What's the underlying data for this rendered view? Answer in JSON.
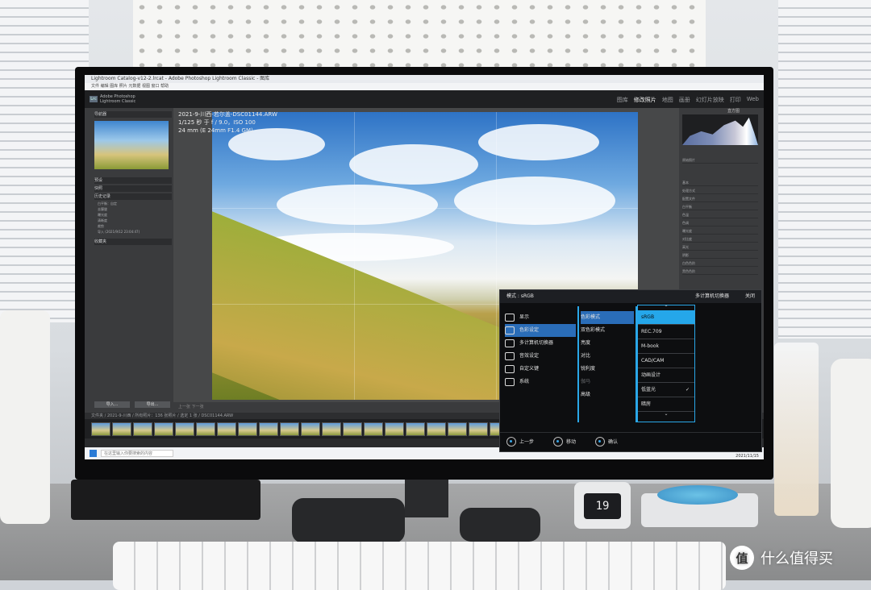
{
  "watermark": {
    "logo": "值",
    "text": "什么值得买"
  },
  "clock": {
    "display": "19"
  },
  "window": {
    "title": "Lightroom Catalog-v12-2.lrcat - Adobe Photoshop Lightroom Classic - 图库",
    "menu": "文件  编辑  图库  照片  元数据  视图  窗口  帮助"
  },
  "lightroom": {
    "brand_top": "Adobe Photoshop",
    "brand_bottom": "Lightroom Classic",
    "modules": [
      "图库",
      "修改照片",
      "地图",
      "画册",
      "幻灯片放映",
      "打印",
      "Web"
    ],
    "active_module": "修改照片",
    "left_panel": {
      "navigator": "导航器",
      "presets": "预设",
      "snapshots": "快照",
      "history": "历史记录",
      "history_items": [
        "白平衡：自定",
        "去朦胧",
        "曝光度",
        "清晰度",
        "裁剪",
        "导入 (2021/9/12 23:04:47)"
      ],
      "collections": "收藏夹",
      "import": "导入...",
      "export": "导出..."
    },
    "photo_info": {
      "filename": "2021-9-川西-若尔盖-DSC01144.ARW",
      "exposure": "1/125 秒 于 f / 9.0，ISO 100",
      "lens": "24 mm (E 24mm F1.4 GM)"
    },
    "bottom_toolbar": "上一张  下一张",
    "right_panel": {
      "histogram_label": "直方图",
      "rows": [
        "原始照片",
        "基本",
        "处理方式",
        "配置文件",
        "白平衡",
        "色温",
        "色调",
        "曝光度",
        "对比度",
        "高光",
        "阴影",
        "白色色阶",
        "黑色色阶"
      ]
    },
    "filmstrip_path": "文件夹 / 2021-9-川西 / 所有照片：136 张照片 / 选定 1 张 / DSC01144.ARW"
  },
  "taskbar": {
    "search": "在这里输入你要搜索的内容",
    "time": "23:04",
    "date": "2021/11/15"
  },
  "osd": {
    "mode_label": "模式",
    "mode_value": "sRGB",
    "selector": "多计算机切换器",
    "close": "关闭",
    "menu": [
      {
        "label": "显示",
        "icon": "display-icon",
        "selected": false
      },
      {
        "label": "色彩设定",
        "icon": "color-palette-icon",
        "selected": true
      },
      {
        "label": "多计算机切换器",
        "icon": "kvm-switch-icon",
        "selected": false
      },
      {
        "label": "音效设定",
        "icon": "speaker-icon",
        "selected": false
      },
      {
        "label": "自定义键",
        "icon": "user-icon",
        "selected": false
      },
      {
        "label": "系统",
        "icon": "wrench-icon",
        "selected": false
      }
    ],
    "submenu": [
      {
        "label": "色彩模式",
        "selected": true,
        "dim": false
      },
      {
        "label": "双色彩模式",
        "selected": false,
        "dim": false
      },
      {
        "label": "亮度",
        "selected": false,
        "dim": false
      },
      {
        "label": "对比",
        "selected": false,
        "dim": false
      },
      {
        "label": "锐利度",
        "selected": false,
        "dim": false
      },
      {
        "label": "伽马",
        "selected": false,
        "dim": true
      },
      {
        "label": "高级",
        "selected": false,
        "dim": false
      }
    ],
    "options": [
      {
        "label": "sRGB",
        "selected": true,
        "checked": false
      },
      {
        "label": "REC.709",
        "selected": false,
        "checked": false
      },
      {
        "label": "M-book",
        "selected": false,
        "checked": false
      },
      {
        "label": "CAD/CAM",
        "selected": false,
        "checked": false
      },
      {
        "label": "动画设计",
        "selected": false,
        "checked": false
      },
      {
        "label": "低蓝光",
        "selected": false,
        "checked": true
      },
      {
        "label": "暗房",
        "selected": false,
        "checked": false
      }
    ],
    "footer": {
      "back": "上一步",
      "move": "移动",
      "confirm": "确认"
    },
    "accent": "#2aa7e8"
  }
}
